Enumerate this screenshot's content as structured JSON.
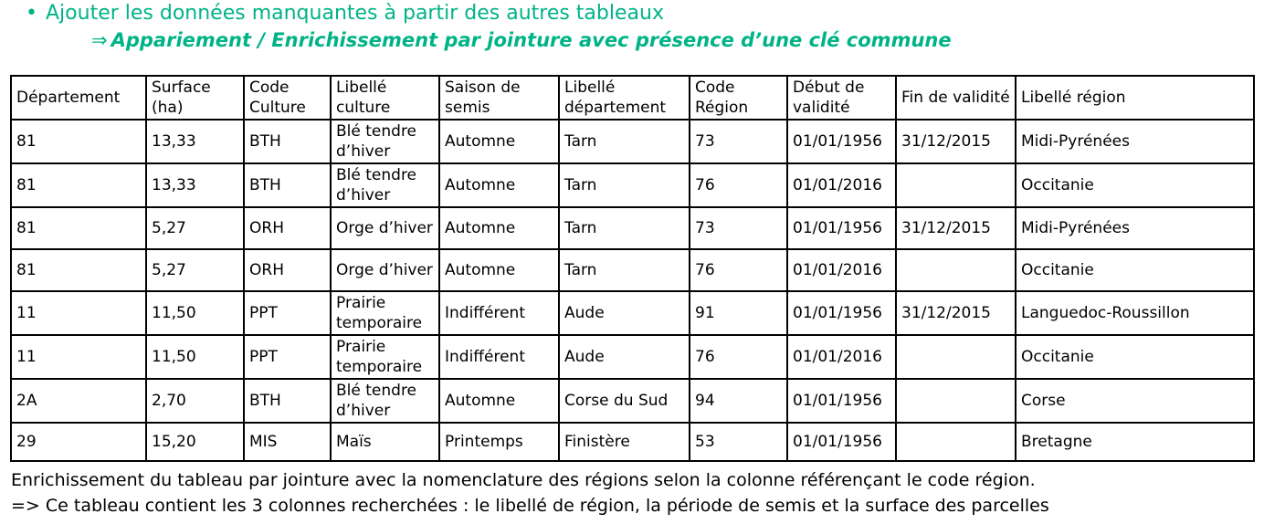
{
  "heading": {
    "bullet": "•",
    "text": "Ajouter les données manquantes à partir des autres tableaux",
    "arrow": "⇒",
    "subtext": "Appariement / Enrichissement par jointure avec présence d’une clé commune",
    "color": "#00b386"
  },
  "table": {
    "columns": [
      "Département",
      "Surface (ha)",
      "Code Culture",
      "Libellé culture",
      "Saison de semis",
      "Libellé département",
      "Code Région",
      "Début de validité",
      "Fin de validité",
      "Libellé région"
    ],
    "rows": [
      [
        "81",
        "13,33",
        "BTH",
        "Blé tendre d’hiver",
        "Automne",
        "Tarn",
        "73",
        "01/01/1956",
        "31/12/2015",
        "Midi-Pyrénées"
      ],
      [
        "81",
        "13,33",
        "BTH",
        "Blé tendre d’hiver",
        "Automne",
        "Tarn",
        "76",
        "01/01/2016",
        "",
        "Occitanie"
      ],
      [
        "81",
        "5,27",
        "ORH",
        "Orge d’hiver",
        "Automne",
        "Tarn",
        "73",
        "01/01/1956",
        "31/12/2015",
        "Midi-Pyrénées"
      ],
      [
        "81",
        "5,27",
        "ORH",
        "Orge d’hiver",
        "Automne",
        "Tarn",
        "76",
        "01/01/2016",
        "",
        "Occitanie"
      ],
      [
        "11",
        "11,50",
        "PPT",
        "Prairie temporaire",
        "Indifférent",
        "Aude",
        "91",
        "01/01/1956",
        "31/12/2015",
        "Languedoc-Roussillon"
      ],
      [
        "11",
        "11,50",
        "PPT",
        "Prairie temporaire",
        "Indifférent",
        "Aude",
        "76",
        "01/01/2016",
        "",
        "Occitanie"
      ],
      [
        "2A",
        "2,70",
        "BTH",
        "Blé tendre d’hiver",
        "Automne",
        "Corse du Sud",
        "94",
        "01/01/1956",
        "",
        "Corse"
      ],
      [
        "29",
        "15,20",
        "MIS",
        "Maïs",
        "Printemps",
        "Finistère",
        "53",
        "01/01/1956",
        "",
        "Bretagne"
      ]
    ]
  },
  "footer": {
    "line1": "Enrichissement du tableau par jointure avec la nomenclature des régions selon la colonne référençant le code région.",
    "line2": "=> Ce tableau contient les 3 colonnes recherchées : le libellé de région, la période de semis et la surface des parcelles"
  }
}
